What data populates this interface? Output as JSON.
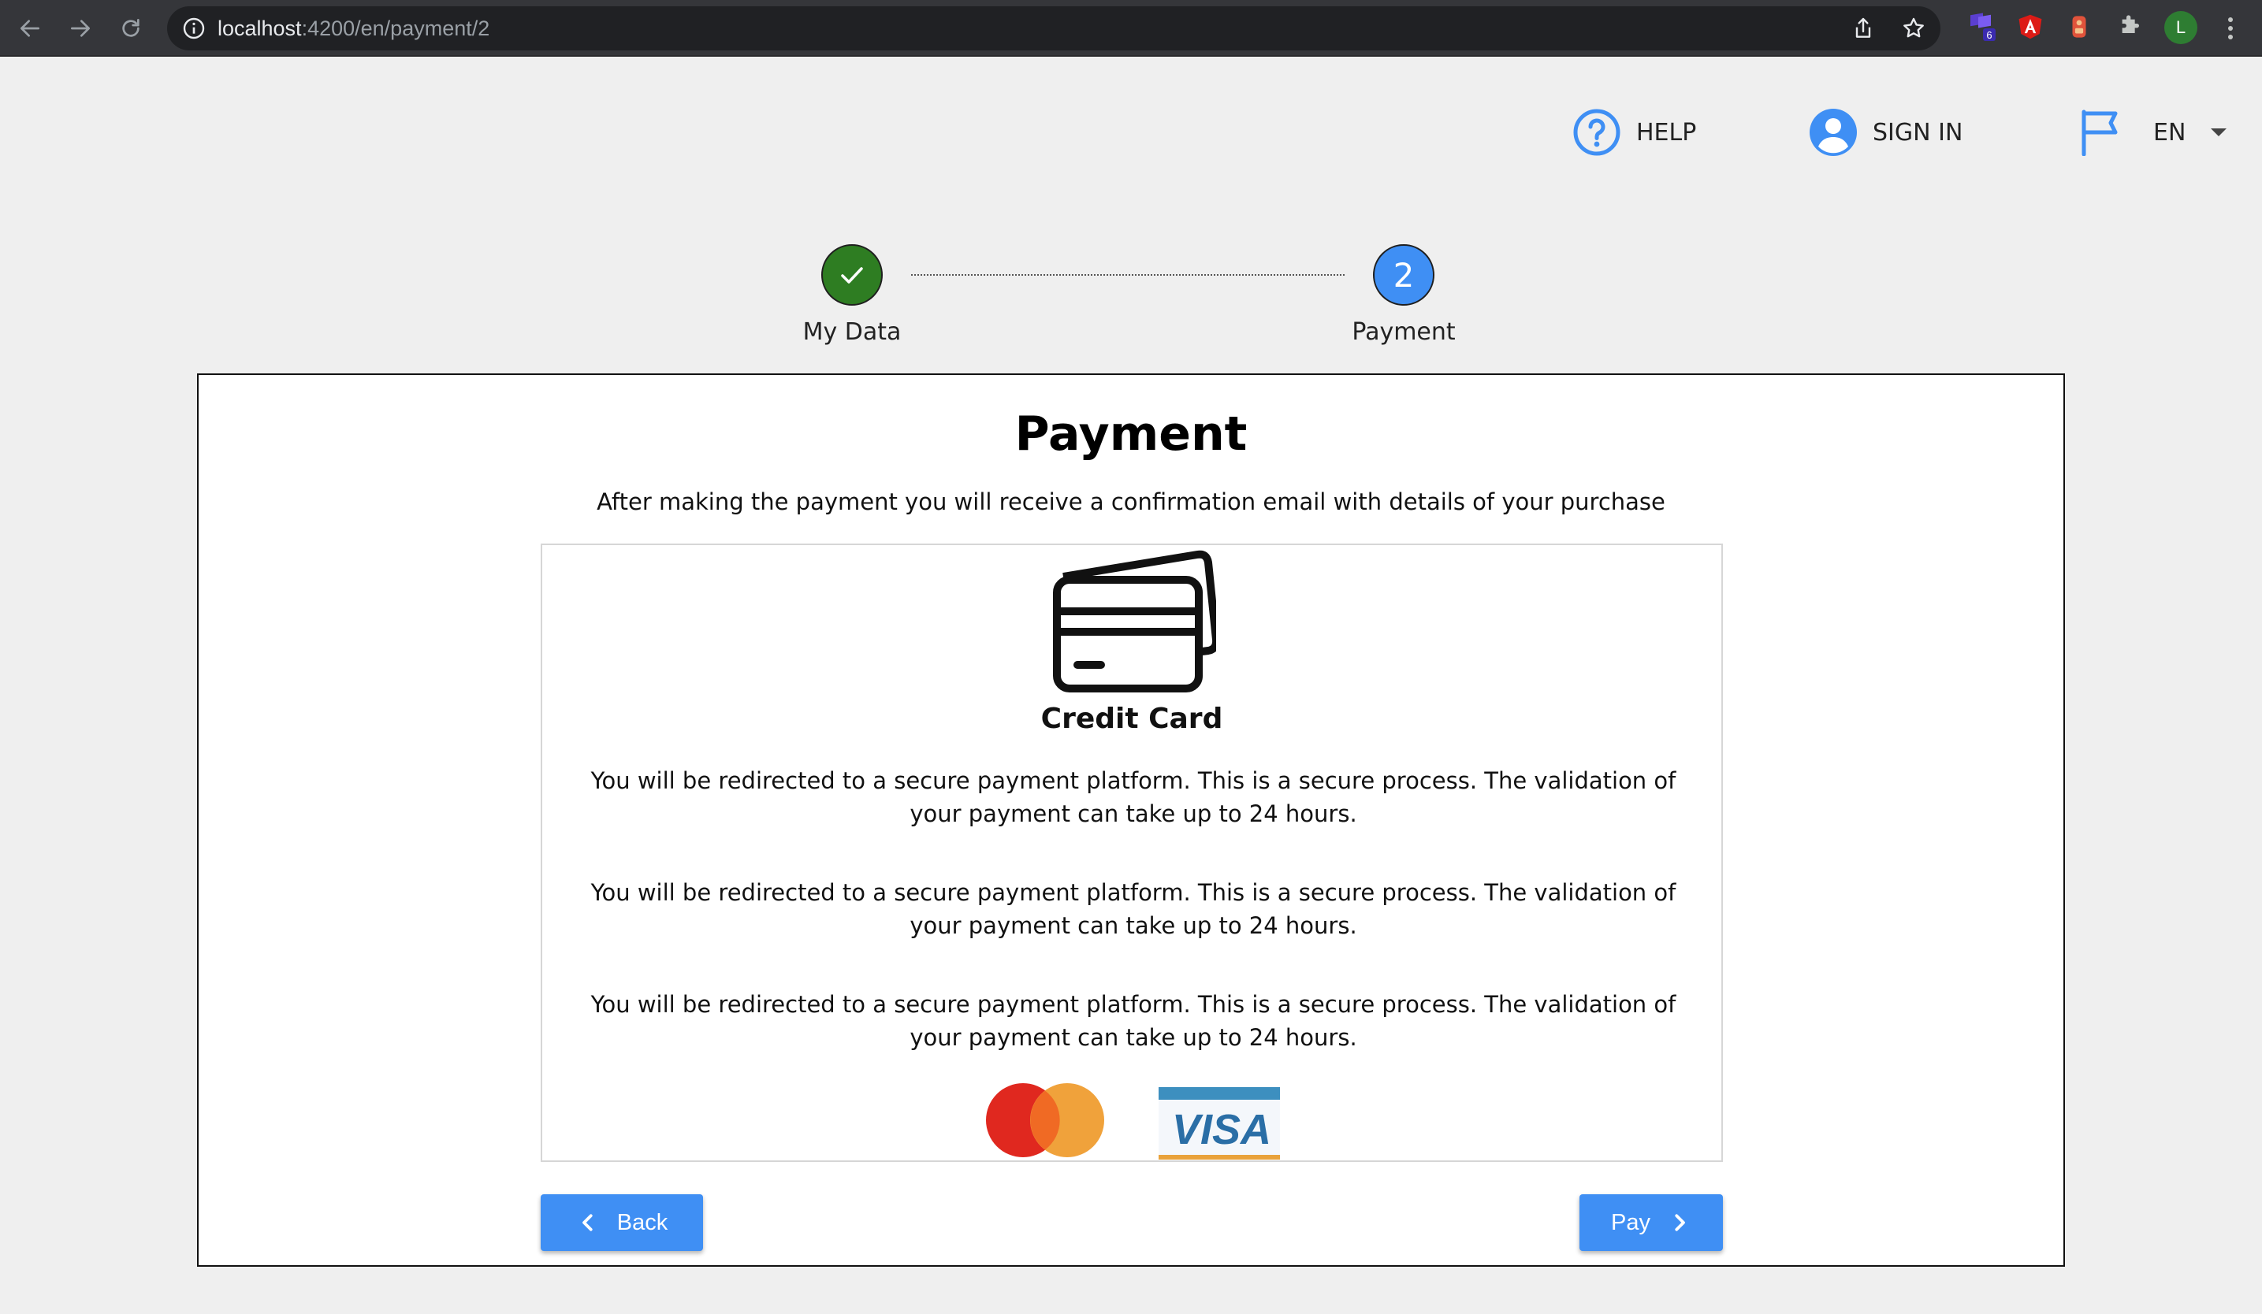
{
  "browser": {
    "url_host": "localhost",
    "url_path": ":4200/en/payment/2",
    "extension_badge": "6",
    "profile_initial": "L"
  },
  "header": {
    "help_label": "HELP",
    "signin_label": "SIGN IN",
    "language_label": "EN"
  },
  "stepper": {
    "steps": [
      {
        "label": "My Data",
        "state": "completed"
      },
      {
        "number": "2",
        "label": "Payment",
        "state": "active"
      }
    ]
  },
  "payment": {
    "title": "Payment",
    "subtitle": "After making the payment you will receive a confirmation email with details of your purchase",
    "method": {
      "title": "Credit Card",
      "icon": "credit-card-icon",
      "paragraphs": [
        "You will be redirected to a secure payment platform. This is a secure process. The validation of your payment can take up to 24 hours.",
        "You will be redirected to a secure payment platform. This is a secure process. The validation of your payment can take up to 24 hours.",
        "You will be redirected to a secure payment platform. This is a secure process. The validation of your payment can take up to 24 hours."
      ],
      "logos": [
        "mastercard-logo",
        "visa-logo"
      ],
      "visa_text": "VISA"
    },
    "back_label": "Back",
    "pay_label": "Pay"
  },
  "colors": {
    "accent": "#3f8ff4",
    "step_done": "#2e7d22",
    "step_active": "#3f8ff4",
    "icon_blue": "#3f8ff4",
    "page_bg": "#efefef"
  }
}
